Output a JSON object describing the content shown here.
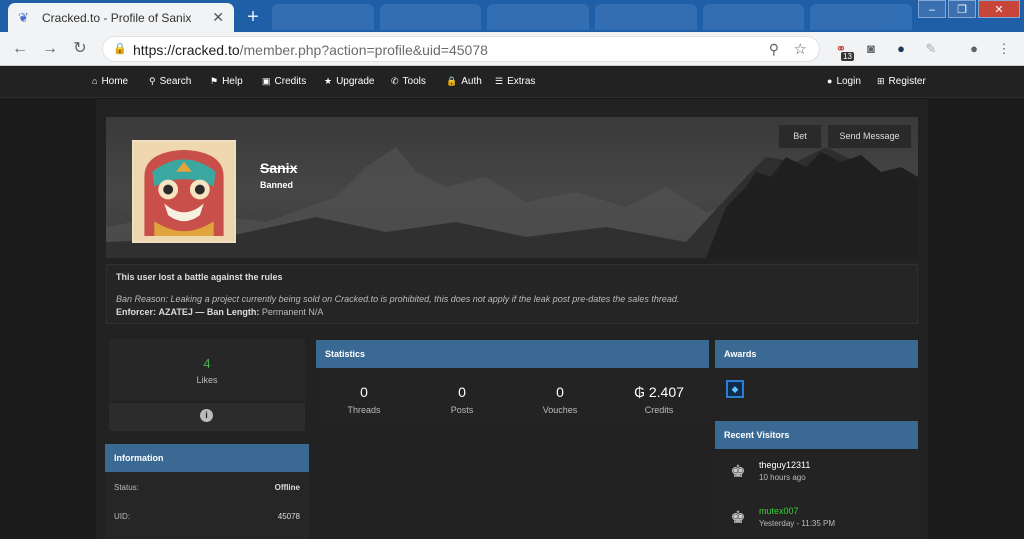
{
  "browser": {
    "tab_title": "Cracked.to - Profile of Sanix",
    "url_scheme": "https://",
    "url_host": "cracked.to",
    "url_path": "/member.php?action=profile&uid=45078",
    "ext_badge": "13"
  },
  "nav": {
    "home": "Home",
    "search": "Search",
    "help": "Help",
    "credits": "Credits",
    "upgrade": "Upgrade",
    "tools": "Tools",
    "auth": "Auth",
    "extras": "Extras",
    "login": "Login",
    "register": "Register"
  },
  "profile": {
    "username": "Sanix",
    "usertitle": "Banned",
    "bet_label": "Bet",
    "message_label": "Send Message"
  },
  "ban": {
    "title": "This user lost a battle against the rules",
    "reason": "Ban Reason: Leaking a project currently being sold on Cracked.to is prohibited, this does not apply if the leak post pre-dates the sales thread.",
    "enforcer_label": "Enforcer:",
    "enforcer": "AZATEJ",
    "length_label": "— Ban Length:",
    "length": "Permanent N/A"
  },
  "likes": {
    "count": "4",
    "label": "Likes"
  },
  "information": {
    "header": "Information",
    "rows": [
      {
        "label": "Status:",
        "value": "Offline"
      },
      {
        "label": "UID:",
        "value": "45078"
      }
    ]
  },
  "statistics": {
    "header": "Statistics",
    "items": [
      {
        "value": "0",
        "label": "Threads"
      },
      {
        "value": "0",
        "label": "Posts"
      },
      {
        "value": "0",
        "label": "Vouches"
      },
      {
        "value": "₲ 2.407",
        "label": "Credits"
      }
    ]
  },
  "awards": {
    "header": "Awards"
  },
  "visitors": {
    "header": "Recent Visitors",
    "items": [
      {
        "name": "theguy12311",
        "time": "10 hours ago"
      },
      {
        "name": "mutex007",
        "time": "Yesterday - 11:35 PM"
      }
    ]
  },
  "colors": {
    "accent": "#3a6a94",
    "likes": "#4caf50",
    "visitor_highlight": "#39d139"
  }
}
